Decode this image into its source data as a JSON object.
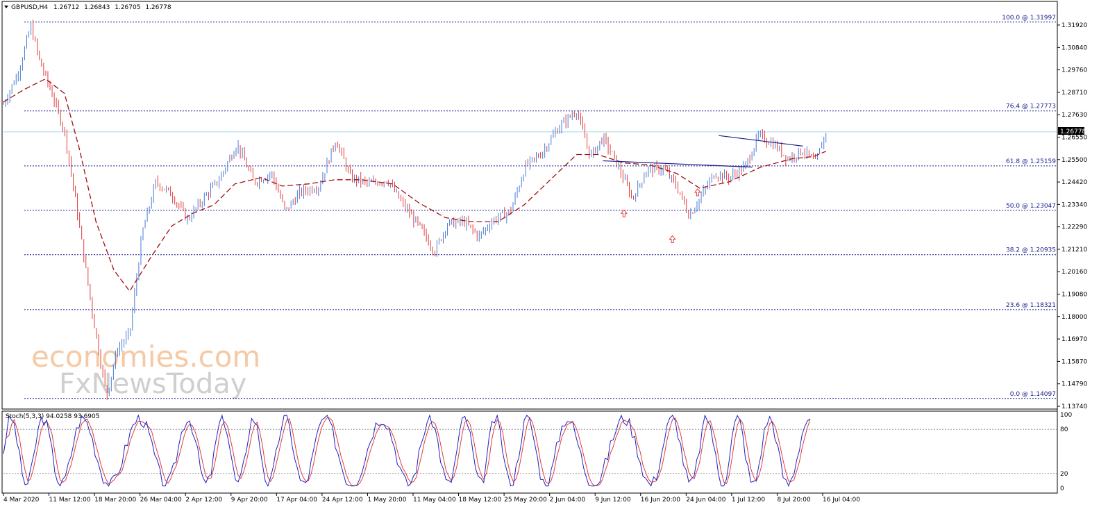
{
  "header": {
    "symbol": "GBPUSD,H4",
    "open": "1.26712",
    "high": "1.26843",
    "low": "1.26705",
    "close": "1.26778"
  },
  "watermark": {
    "line1": "economies.com",
    "line2": "FxNewsToday"
  },
  "current_price_label": "1.26778",
  "colors": {
    "bull": "#4a7bd6",
    "bear": "#e03c3c",
    "ma": "#a01010",
    "fib": "#1a1a8c",
    "price_line": "#a8d8ea",
    "trend": "#1a1a8c",
    "stoch_k": "#2020c0",
    "stoch_d": "#e03c3c",
    "arrow": "#e03c3c"
  },
  "chart_data": [
    {
      "type": "candlestick",
      "title": "GBPUSD,H4",
      "ylim": [
        1.1374,
        1.3245
      ],
      "y_ticks": [
        "1.31920",
        "1.30840",
        "1.29760",
        "1.28710",
        "1.27630",
        "1.26550",
        "1.25500",
        "1.24420",
        "1.23340",
        "1.22290",
        "1.21210",
        "1.20160",
        "1.19080",
        "1.18000",
        "1.16970",
        "1.15870",
        "1.14790",
        "1.13740"
      ],
      "x_ticks": [
        "4 Mar 2020",
        "11 Mar 12:00",
        "18 Mar 20:00",
        "26 Mar 04:00",
        "2 Apr 12:00",
        "9 Apr 20:00",
        "17 Apr 04:00",
        "24 Apr 12:00",
        "1 May 20:00",
        "11 May 04:00",
        "18 May 12:00",
        "25 May 20:00",
        "2 Jun 04:00",
        "9 Jun 12:00",
        "16 Jun 20:00",
        "24 Jun 04:00",
        "1 Jul 12:00",
        "8 Jul 20:00",
        "16 Jul 04:00"
      ],
      "price_path": [
        {
          "t": 0,
          "p": 1.281
        },
        {
          "t": 0.014,
          "p": 1.296
        },
        {
          "t": 0.026,
          "p": 1.318
        },
        {
          "t": 0.034,
          "p": 1.302
        },
        {
          "t": 0.046,
          "p": 1.286
        },
        {
          "t": 0.058,
          "p": 1.268
        },
        {
          "t": 0.07,
          "p": 1.23
        },
        {
          "t": 0.085,
          "p": 1.18
        },
        {
          "t": 0.098,
          "p": 1.142
        },
        {
          "t": 0.108,
          "p": 1.164
        },
        {
          "t": 0.12,
          "p": 1.172
        },
        {
          "t": 0.132,
          "p": 1.22
        },
        {
          "t": 0.145,
          "p": 1.244
        },
        {
          "t": 0.16,
          "p": 1.238
        },
        {
          "t": 0.175,
          "p": 1.226
        },
        {
          "t": 0.19,
          "p": 1.236
        },
        {
          "t": 0.205,
          "p": 1.245
        },
        {
          "t": 0.222,
          "p": 1.262
        },
        {
          "t": 0.238,
          "p": 1.244
        },
        {
          "t": 0.255,
          "p": 1.248
        },
        {
          "t": 0.268,
          "p": 1.23
        },
        {
          "t": 0.282,
          "p": 1.239
        },
        {
          "t": 0.3,
          "p": 1.242
        },
        {
          "t": 0.316,
          "p": 1.264
        },
        {
          "t": 0.33,
          "p": 1.246
        },
        {
          "t": 0.348,
          "p": 1.243
        },
        {
          "t": 0.365,
          "p": 1.245
        },
        {
          "t": 0.38,
          "p": 1.233
        },
        {
          "t": 0.395,
          "p": 1.223
        },
        {
          "t": 0.41,
          "p": 1.211
        },
        {
          "t": 0.422,
          "p": 1.224
        },
        {
          "t": 0.438,
          "p": 1.225
        },
        {
          "t": 0.452,
          "p": 1.218
        },
        {
          "t": 0.466,
          "p": 1.226
        },
        {
          "t": 0.482,
          "p": 1.23
        },
        {
          "t": 0.496,
          "p": 1.251
        },
        {
          "t": 0.512,
          "p": 1.258
        },
        {
          "t": 0.528,
          "p": 1.27
        },
        {
          "t": 0.545,
          "p": 1.278
        },
        {
          "t": 0.558,
          "p": 1.256
        },
        {
          "t": 0.57,
          "p": 1.265
        },
        {
          "t": 0.582,
          "p": 1.254
        },
        {
          "t": 0.598,
          "p": 1.236
        },
        {
          "t": 0.612,
          "p": 1.25
        },
        {
          "t": 0.628,
          "p": 1.25
        },
        {
          "t": 0.64,
          "p": 1.242
        },
        {
          "t": 0.652,
          "p": 1.228
        },
        {
          "t": 0.662,
          "p": 1.236
        },
        {
          "t": 0.676,
          "p": 1.248
        },
        {
          "t": 0.69,
          "p": 1.246
        },
        {
          "t": 0.705,
          "p": 1.251
        },
        {
          "t": 0.718,
          "p": 1.266
        },
        {
          "t": 0.732,
          "p": 1.262
        },
        {
          "t": 0.746,
          "p": 1.255
        },
        {
          "t": 0.76,
          "p": 1.259
        },
        {
          "t": 0.772,
          "p": 1.253
        },
        {
          "t": 0.782,
          "p": 1.2677
        }
      ],
      "ma_path": [
        {
          "t": 0,
          "p": 1.282
        },
        {
          "t": 0.02,
          "p": 1.288
        },
        {
          "t": 0.04,
          "p": 1.293
        },
        {
          "t": 0.058,
          "p": 1.286
        },
        {
          "t": 0.072,
          "p": 1.26
        },
        {
          "t": 0.088,
          "p": 1.225
        },
        {
          "t": 0.105,
          "p": 1.202
        },
        {
          "t": 0.12,
          "p": 1.192
        },
        {
          "t": 0.14,
          "p": 1.208
        },
        {
          "t": 0.16,
          "p": 1.223
        },
        {
          "t": 0.18,
          "p": 1.229
        },
        {
          "t": 0.2,
          "p": 1.233
        },
        {
          "t": 0.22,
          "p": 1.243
        },
        {
          "t": 0.245,
          "p": 1.246
        },
        {
          "t": 0.265,
          "p": 1.242
        },
        {
          "t": 0.29,
          "p": 1.243
        },
        {
          "t": 0.315,
          "p": 1.245
        },
        {
          "t": 0.34,
          "p": 1.245
        },
        {
          "t": 0.37,
          "p": 1.243
        },
        {
          "t": 0.395,
          "p": 1.234
        },
        {
          "t": 0.42,
          "p": 1.227
        },
        {
          "t": 0.445,
          "p": 1.225
        },
        {
          "t": 0.47,
          "p": 1.225
        },
        {
          "t": 0.495,
          "p": 1.233
        },
        {
          "t": 0.52,
          "p": 1.245
        },
        {
          "t": 0.545,
          "p": 1.257
        },
        {
          "t": 0.565,
          "p": 1.257
        },
        {
          "t": 0.59,
          "p": 1.253
        },
        {
          "t": 0.615,
          "p": 1.252
        },
        {
          "t": 0.64,
          "p": 1.248
        },
        {
          "t": 0.662,
          "p": 1.241
        },
        {
          "t": 0.69,
          "p": 1.244
        },
        {
          "t": 0.72,
          "p": 1.251
        },
        {
          "t": 0.75,
          "p": 1.255
        },
        {
          "t": 0.77,
          "p": 1.256
        },
        {
          "t": 0.782,
          "p": 1.2585
        }
      ],
      "fib_levels": [
        {
          "label": "100.0 @ 1.31997",
          "price": 1.31997
        },
        {
          "label": "76.4 @ 1.27773",
          "price": 1.27773
        },
        {
          "label": "61.8 @ 1.25159",
          "price": 1.25159
        },
        {
          "label": "50.0 @ 1.23047",
          "price": 1.23047
        },
        {
          "label": "38.2 @ 1.20935",
          "price": 1.20935
        },
        {
          "label": "23.6 @ 1.18321",
          "price": 1.18321
        },
        {
          "label": "0.0 @ 1.14097",
          "price": 1.14097
        }
      ],
      "current_price": 1.26778,
      "trend_lines": [
        {
          "t1": 0.57,
          "p1": 1.254,
          "t2": 0.712,
          "p2": 1.251
        },
        {
          "t1": 0.68,
          "p1": 1.266,
          "t2": 0.76,
          "p2": 1.261
        }
      ],
      "arrows": [
        {
          "t": 0.59,
          "p": 1.229
        },
        {
          "t": 0.636,
          "p": 1.2167
        },
        {
          "t": 0.66,
          "p": 1.239
        }
      ]
    },
    {
      "type": "line",
      "title": "Stoch(5,3,3) 94.0258 93.6905",
      "ylim": [
        0,
        100
      ],
      "y_ticks": [
        "100",
        "80",
        "20",
        "0"
      ],
      "levels": [
        80,
        20
      ]
    }
  ]
}
